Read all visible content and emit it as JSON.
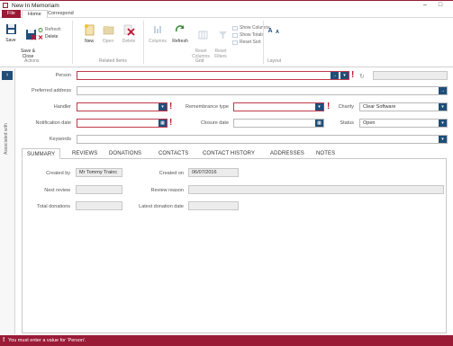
{
  "window": {
    "title": "New In Memoriam",
    "minimize": "–",
    "maximize": "□"
  },
  "menu": {
    "file": "File",
    "home": "Home",
    "correspond": "Correspond"
  },
  "ribbon": {
    "save": "Save",
    "save_close": "Save &\nClose",
    "refresh": "Refresh",
    "delete": "Delete",
    "new": "New",
    "open": "Open",
    "delete2": "Delete",
    "columns": "Columns",
    "refresh2": "Refresh",
    "reset_columns": "Reset\nColumns",
    "reset_filters": "Reset\nFilters",
    "show_columns": "Show Columns",
    "show_totals": "Show Totals",
    "reset_sort": "Reset Sort",
    "groups": {
      "actions": "Actions",
      "related_items": "Related Items",
      "grid": "Grid",
      "layout": "Layout"
    }
  },
  "sidebar": {
    "label": "Associated with"
  },
  "form": {
    "person_label": "Person",
    "preferred_address_label": "Preferred address",
    "handler_label": "Handler",
    "remembrance_type_label": "Remembrance type",
    "charity_label": "Charity",
    "charity_value": "Clear Software",
    "notification_date_label": "Notification date",
    "closure_date_label": "Closure date",
    "status_label": "Status",
    "status_value": "Open",
    "keywords_label": "Keywords",
    "refresh_symbol": "↻"
  },
  "tabs": [
    "SUMMARY",
    "REVIEWS",
    "DONATIONS",
    "CONTACTS",
    "CONTACT HISTORY",
    "ADDRESSES",
    "NOTES"
  ],
  "summary": {
    "created_by_label": "Created by",
    "created_by_value": "Mr Tommy Trainc",
    "created_on_label": "Created on",
    "created_on_value": "06/07/2016",
    "next_review_label": "Next review",
    "review_reason_label": "Review reason",
    "total_donations_label": "Total donations",
    "latest_donation_label": "Latest donation date"
  },
  "status": {
    "message": "You must enter a value for 'Person'."
  },
  "colors": {
    "brand": "#9a1b36",
    "accent": "#1f4e79",
    "required": "#c0152f"
  }
}
